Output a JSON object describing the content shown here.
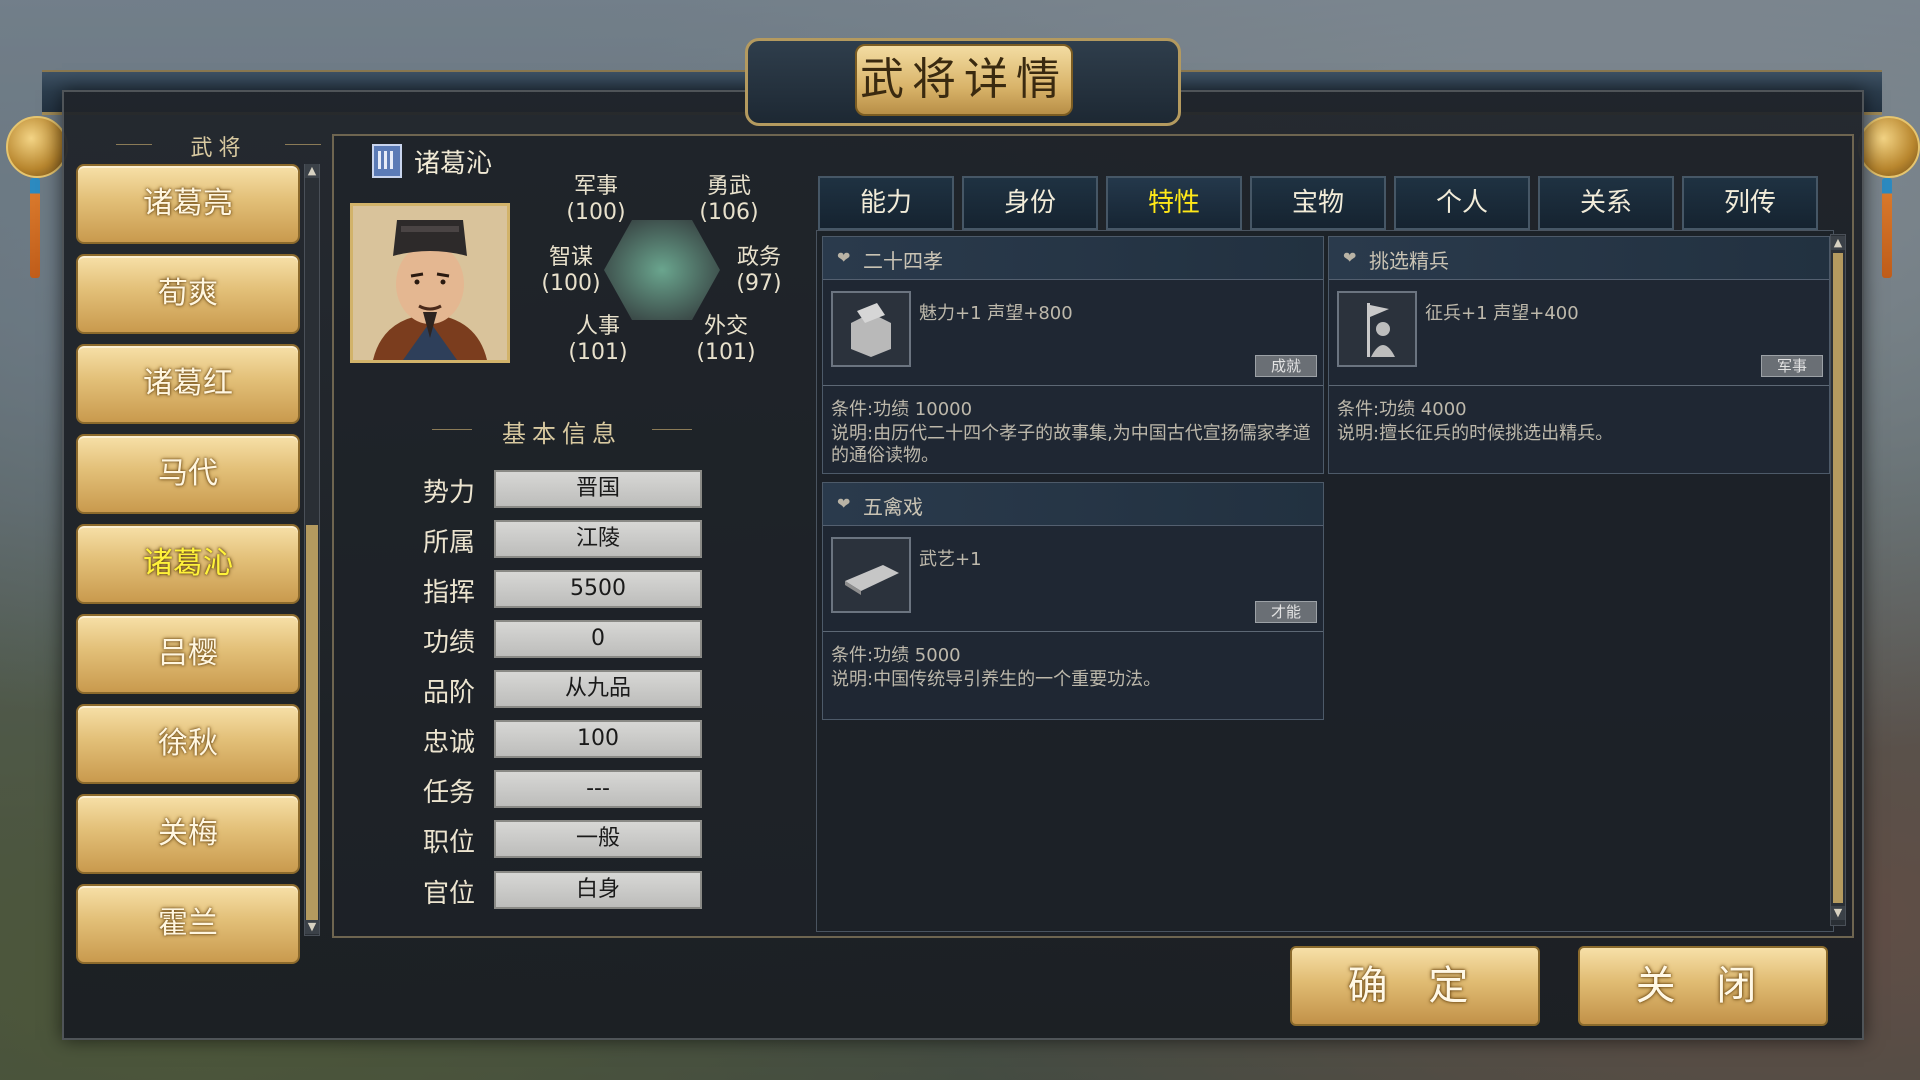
{
  "window_title": "武将详情",
  "list_header": "武将",
  "generals": [
    "诸葛亮",
    "荀爽",
    "诸葛红",
    "马代",
    "诸葛沁",
    "吕樱",
    "徐秋",
    "关梅",
    "霍兰"
  ],
  "selected_general": "诸葛沁",
  "stats": {
    "military": {
      "label": "军事",
      "value": "(100)"
    },
    "valor": {
      "label": "勇武",
      "value": "(106)"
    },
    "strategy": {
      "label": "智谋",
      "value": "(100)"
    },
    "politics": {
      "label": "政务",
      "value": "(97)"
    },
    "personnel": {
      "label": "人事",
      "value": "(101)"
    },
    "diplomacy": {
      "label": "外交",
      "value": "(101)"
    }
  },
  "basic_info_title": "基本信息",
  "basic_info": [
    {
      "label": "势力",
      "value": "晋国"
    },
    {
      "label": "所属",
      "value": "江陵"
    },
    {
      "label": "指挥",
      "value": "5500"
    },
    {
      "label": "功绩",
      "value": "0"
    },
    {
      "label": "品阶",
      "value": "从九品"
    },
    {
      "label": "忠诚",
      "value": "100"
    },
    {
      "label": "任务",
      "value": "---"
    },
    {
      "label": "职位",
      "value": "一般"
    },
    {
      "label": "官位",
      "value": "白身"
    }
  ],
  "tabs": [
    "能力",
    "身份",
    "特性",
    "宝物",
    "个人",
    "关系",
    "列传"
  ],
  "active_tab": "特性",
  "traits": [
    {
      "title": "二十四孝",
      "effect": "魅力+1 声望+800",
      "tag": "成就",
      "condition": "条件:功绩 10000",
      "desc": "说明:由历代二十四个孝子的故事集,为中国古代宣扬儒家孝道的通俗读物。"
    },
    {
      "title": "挑选精兵",
      "effect": "征兵+1 声望+400",
      "tag": "军事",
      "condition": "条件:功绩 4000",
      "desc": "说明:擅长征兵的时候挑选出精兵。"
    },
    {
      "title": "五禽戏",
      "effect": "武艺+1",
      "tag": "才能",
      "condition": "条件:功绩 5000",
      "desc": "说明:中国传统导引养生的一个重要功法。"
    }
  ],
  "buttons": {
    "confirm": "确 定",
    "close": "关 闭"
  },
  "colors": {
    "gold": "#e2bf77",
    "active_text": "#ffe818",
    "panel": "#1f2630"
  }
}
